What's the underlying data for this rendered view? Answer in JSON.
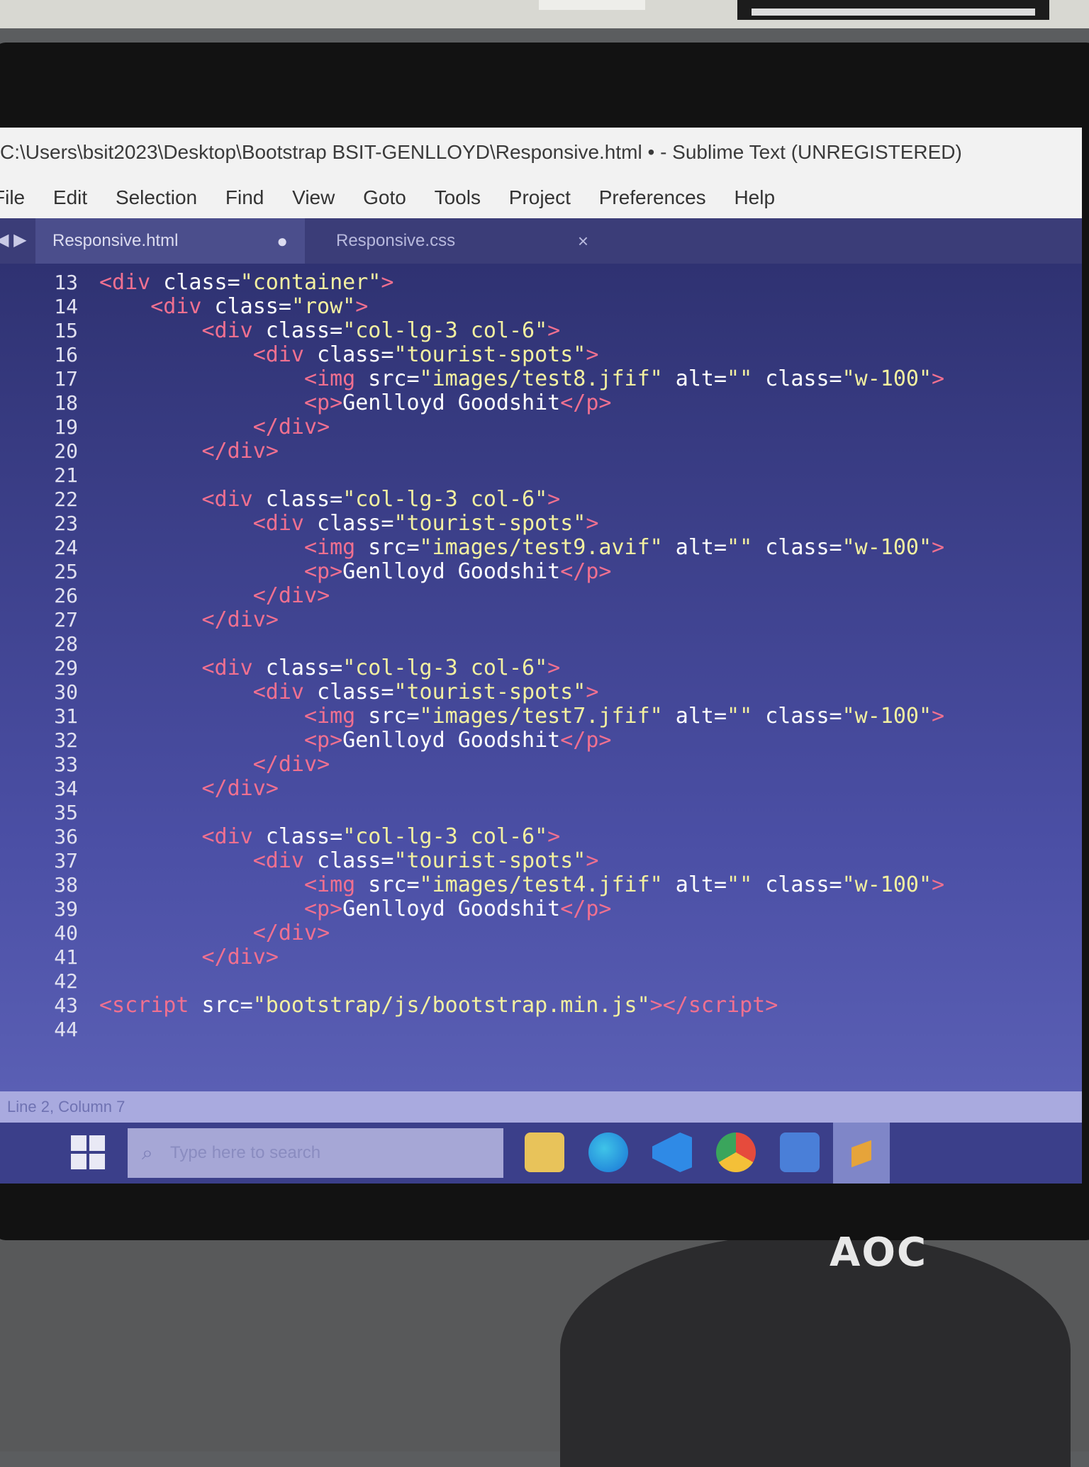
{
  "window": {
    "title": "C:\\Users\\bsit2023\\Desktop\\Bootstrap BSIT-GENLLOYD\\Responsive.html • - Sublime Text (UNREGISTERED)"
  },
  "menu": [
    "File",
    "Edit",
    "Selection",
    "Find",
    "View",
    "Goto",
    "Tools",
    "Project",
    "Preferences",
    "Help"
  ],
  "tabs": [
    {
      "label": "Responsive.html",
      "active": true,
      "modified": true
    },
    {
      "label": "Responsive.css",
      "active": false
    }
  ],
  "editor": {
    "line_numbers": [
      "13",
      "14",
      "15",
      "16",
      "17",
      "18",
      "19",
      "20",
      "21",
      "22",
      "23",
      "24",
      "25",
      "26",
      "27",
      "28",
      "29",
      "30",
      "31",
      "32",
      "33",
      "34",
      "35",
      "36",
      "37",
      "38",
      "39",
      "40",
      "41",
      "42",
      "43",
      "44"
    ]
  },
  "status": {
    "text": "Line 2, Column 7"
  },
  "taskbar": {
    "search_placeholder": "Type here to search",
    "icons": [
      "windows-start-icon",
      "file-explorer-icon",
      "edge-icon",
      "vscode-icon",
      "chrome-icon",
      "app-icon",
      "sublime-text-icon"
    ]
  },
  "monitor": {
    "brand": "AOC"
  },
  "colors": {
    "editor_bg": "#2b2e6e",
    "tag": "#f07090",
    "string": "#f3f0a0",
    "text": "#ffffff"
  }
}
